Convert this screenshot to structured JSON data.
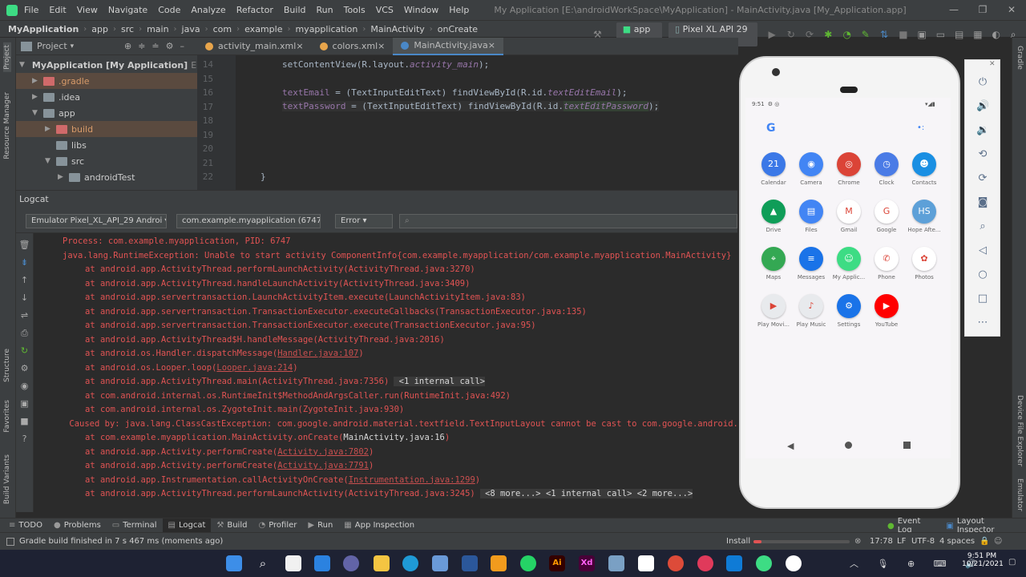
{
  "menubar": {
    "items": [
      "File",
      "Edit",
      "View",
      "Navigate",
      "Code",
      "Analyze",
      "Refactor",
      "Build",
      "Run",
      "Tools",
      "VCS",
      "Window",
      "Help"
    ],
    "title": "My Application [E:\\androidWorkSpace\\MyApplication] - MainActivity.java [My_Application.app]"
  },
  "navbar": {
    "crumbs": [
      "MyApplication",
      "app",
      "src",
      "main",
      "java",
      "com",
      "example",
      "myapplication",
      "MainActivity",
      "onCreate"
    ],
    "run_config": "app",
    "device": "Pixel XL API 29"
  },
  "project_panel": {
    "title": "Project",
    "items": [
      {
        "label": "MyApplication [My Application]",
        "suffix": "E:\\andro",
        "indent": 0,
        "arrow": "▼",
        "kind": "root"
      },
      {
        "label": ".gradle",
        "indent": 1,
        "arrow": "▶",
        "kind": "orange"
      },
      {
        "label": ".idea",
        "indent": 1,
        "arrow": "▶",
        "kind": "grey"
      },
      {
        "label": "app",
        "indent": 1,
        "arrow": "▼",
        "kind": "grey"
      },
      {
        "label": "build",
        "indent": 2,
        "arrow": "▶",
        "kind": "orange"
      },
      {
        "label": "libs",
        "indent": 2,
        "arrow": "",
        "kind": "grey"
      },
      {
        "label": "src",
        "indent": 2,
        "arrow": "▼",
        "kind": "grey"
      },
      {
        "label": "androidTest",
        "indent": 3,
        "arrow": "▶",
        "kind": "grey"
      }
    ]
  },
  "tabs": [
    {
      "label": "activity_main.xml",
      "active": false
    },
    {
      "label": "colors.xml",
      "active": false
    },
    {
      "label": "MainActivity.java",
      "active": true
    }
  ],
  "editor": {
    "line_numbers": [
      "14",
      "15",
      "16",
      "17",
      "18",
      "19",
      "20",
      "21",
      "22"
    ],
    "line14": "setContentView(R.layout.",
    "line14b": "activity_main",
    "line14c": ");",
    "line16a": "textEmail",
    "line16b": " = (TextInputEditText) findViewById(R.id.",
    "line16c": "textEditEmail",
    "line16d": ");",
    "line17a": "textPassword",
    "line17b": " = (TextInputEditText) findViewById(R.id.",
    "line17c": "textEditPassword",
    "line17d": ");",
    "line22": "}"
  },
  "logcat": {
    "title": "Logcat",
    "device": "Emulator Pixel_XL_API_29 Androi",
    "process": "com.example.myapplication (6747)",
    "level": "Error",
    "lines": [
      {
        "indent": 0,
        "text": "Process: com.example.myapplication, PID: 6747"
      },
      {
        "indent": 0,
        "text": "java.lang.RuntimeException: Unable to start activity ComponentInfo{com.example.myapplication/com.example.myapplication.MainActivity}"
      },
      {
        "indent": 1,
        "text": "at android.app.ActivityThread.performLaunchActivity(ActivityThread.java:3270)"
      },
      {
        "indent": 1,
        "text": "at android.app.ActivityThread.handleLaunchActivity(ActivityThread.java:3409)"
      },
      {
        "indent": 1,
        "text": "at android.app.servertransaction.LaunchActivityItem.execute(LaunchActivityItem.java:83)"
      },
      {
        "indent": 1,
        "text": "at android.app.servertransaction.TransactionExecutor.executeCallbacks(TransactionExecutor.java:135)"
      },
      {
        "indent": 1,
        "text": "at android.app.servertransaction.TransactionExecutor.execute(TransactionExecutor.java:95)"
      },
      {
        "indent": 1,
        "text": "at android.app.ActivityThread$H.handleMessage(ActivityThread.java:2016)"
      },
      {
        "indent": 1,
        "text": "at android.os.Handler.dispatchMessage(",
        "link": "Handler.java:107",
        "tail": ")"
      },
      {
        "indent": 1,
        "text": "at android.os.Looper.loop(",
        "link": "Looper.java:214",
        "tail": ")"
      },
      {
        "indent": 1,
        "text": "at android.app.ActivityThread.main(ActivityThread.java:7356)",
        "extra": "<1 internal call>"
      },
      {
        "indent": 1,
        "text": "at com.android.internal.os.RuntimeInit$MethodAndArgsCaller.run(RuntimeInit.java:492)"
      },
      {
        "indent": 1,
        "text": "at com.android.internal.os.ZygoteInit.main(ZygoteInit.java:930)"
      },
      {
        "indent": 0.3,
        "text": "Caused by: java.lang.ClassCastException: com.google.android.material.textfield.TextInputLayout cannot be cast to com.google.android.material.textfield.TextInputEditText"
      },
      {
        "indent": 1,
        "text": "at com.example.myapplication.MainActivity.onCreate(",
        "link": "MainActivity.java:16",
        "tail": ")",
        "ok": true
      },
      {
        "indent": 1,
        "text": "at android.app.Activity.performCreate(",
        "link": "Activity.java:7802",
        "tail": ")"
      },
      {
        "indent": 1,
        "text": "at android.app.Activity.performCreate(",
        "link": "Activity.java:7791",
        "tail": ")"
      },
      {
        "indent": 1,
        "text": "at android.app.Instrumentation.callActivityOnCreate(",
        "link": "Instrumentation.java:1299",
        "tail": ")"
      },
      {
        "indent": 1,
        "text": "at android.app.ActivityThread.performLaunchActivity(ActivityThread.java:3245)",
        "extra": "<8 more...> <1 internal call> <2 more...>"
      }
    ]
  },
  "phone": {
    "time": "9:51",
    "apps": [
      {
        "label": "Calendar",
        "color": "#3b78e7",
        "glyph": "21"
      },
      {
        "label": "Camera",
        "color": "#4285f4",
        "glyph": "◉"
      },
      {
        "label": "Chrome",
        "color": "#db4437",
        "glyph": "◎"
      },
      {
        "label": "Clock",
        "color": "#4a7be6",
        "glyph": "◷"
      },
      {
        "label": "Contacts",
        "color": "#1a8fe3",
        "glyph": "☻"
      },
      {
        "label": "Drive",
        "color": "#0f9d58",
        "glyph": "▲"
      },
      {
        "label": "Files",
        "color": "#4285f4",
        "glyph": "▤"
      },
      {
        "label": "Gmail",
        "color": "#ffffff",
        "glyph": "M"
      },
      {
        "label": "Google",
        "color": "#ffffff",
        "glyph": "G"
      },
      {
        "label": "Hope Afte...",
        "color": "#5da0d8",
        "glyph": "HS"
      },
      {
        "label": "Maps",
        "color": "#34a853",
        "glyph": "⌖"
      },
      {
        "label": "Messages",
        "color": "#1a73e8",
        "glyph": "≡"
      },
      {
        "label": "My Applic...",
        "color": "#3ddc84",
        "glyph": "☺"
      },
      {
        "label": "Phone",
        "color": "#ffffff",
        "glyph": "✆"
      },
      {
        "label": "Photos",
        "color": "#ffffff",
        "glyph": "✿"
      },
      {
        "label": "Play Movi...",
        "color": "#e8eaed",
        "glyph": "▶"
      },
      {
        "label": "Play Music",
        "color": "#e8eaed",
        "glyph": "♪"
      },
      {
        "label": "Settings",
        "color": "#1a73e8",
        "glyph": "⚙"
      },
      {
        "label": "YouTube",
        "color": "#ff0000",
        "glyph": "▶"
      }
    ]
  },
  "tool_tabs": [
    {
      "label": "TODO",
      "active": false
    },
    {
      "label": "Problems",
      "active": false
    },
    {
      "label": "Terminal",
      "active": false
    },
    {
      "label": "Logcat",
      "active": true
    },
    {
      "label": "Build",
      "active": false
    },
    {
      "label": "Profiler",
      "active": false
    },
    {
      "label": "Run",
      "active": false
    },
    {
      "label": "App Inspection",
      "active": false
    }
  ],
  "tool_tabs_right": [
    "Event Log",
    "Layout Inspector"
  ],
  "status": {
    "message": "Gradle build finished in 7 s 467 ms (moments ago)",
    "install": "Install",
    "position": "17:78",
    "line_sep": "LF",
    "encoding": "UTF-8",
    "indent": "4 spaces"
  },
  "left_stripe": [
    "Project",
    "Resource Manager",
    "Structure",
    "Favorites",
    "Build Variants"
  ],
  "right_stripe": [
    "Gradle",
    "Device File Explorer",
    "Emulator"
  ],
  "clock": {
    "time": "9:51 PM",
    "date": "10/21/2021"
  },
  "colors": {
    "accent": "#4a88c7",
    "error": "#e05353",
    "bg": "#2b2b2b",
    "panel": "#3c3f41"
  }
}
